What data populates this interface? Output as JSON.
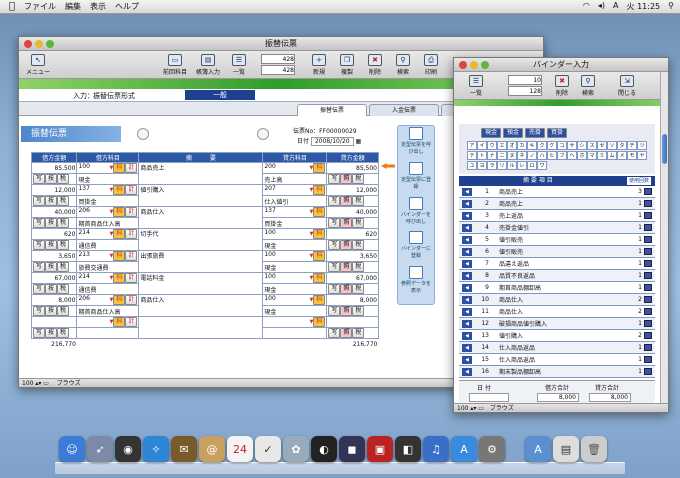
{
  "menubar": {
    "items": [
      "ファイル",
      "編集",
      "表示",
      "ヘルプ"
    ],
    "clock": "火 11:25",
    "user": "A"
  },
  "main": {
    "title": "振替伝票",
    "toolbar": {
      "menu": "メニュー",
      "prev": "前回科目",
      "swap": "帳簿入力",
      "list": "一覧",
      "rec1": "428",
      "rec2": "428",
      "new": "新規",
      "copy": "複製",
      "delete": "削除",
      "search": "検索",
      "print": "印刷"
    },
    "input_label": "入力：",
    "form_type": "振替伝票形式",
    "mode": "一般",
    "tabs": [
      "振替伝票",
      "入金伝票",
      "出金伝"
    ],
    "voucher_title": "振替伝票",
    "voucher_no_label": "伝票No：",
    "voucher_no": "FF00000029",
    "date_label": "日付",
    "date": "2008/10/20",
    "headers": [
      "借方金額",
      "借方科目",
      "摘　　　要",
      "貸方科目",
      "貸方金額"
    ],
    "rows": [
      {
        "debit_amt": "85,500",
        "debit_code": "100",
        "debit_name": "現金",
        "memo": "商品売上",
        "credit_code": "200",
        "credit_name": "売上高",
        "credit_amt": "85,500"
      },
      {
        "debit_amt": "12,000",
        "debit_code": "137",
        "debit_name": "買掛金",
        "memo": "値引購入",
        "credit_code": "207",
        "credit_name": "仕入値引",
        "credit_amt": "12,000"
      },
      {
        "debit_amt": "40,000",
        "debit_code": "206",
        "debit_name": "期首商品仕入高",
        "memo": "商品仕入",
        "credit_code": "137",
        "credit_name": "買掛金",
        "credit_amt": "40,000"
      },
      {
        "debit_amt": "620",
        "debit_code": "214",
        "debit_name": "通信費",
        "memo": "切手代",
        "credit_code": "100",
        "credit_name": "現金",
        "credit_amt": "620"
      },
      {
        "debit_amt": "3,650",
        "debit_code": "213",
        "debit_name": "旅費交通費",
        "memo": "出張旅費",
        "credit_code": "100",
        "credit_name": "現金",
        "credit_amt": "3,650"
      },
      {
        "debit_amt": "67,000",
        "debit_code": "214",
        "debit_name": "通信費",
        "memo": "電話料金",
        "credit_code": "100",
        "credit_name": "現金",
        "credit_amt": "67,000"
      },
      {
        "debit_amt": "8,000",
        "debit_code": "206",
        "debit_name": "期首商品仕入高",
        "memo": "商品仕入",
        "credit_code": "100",
        "credit_name": "現金",
        "credit_amt": "8,000"
      },
      {
        "debit_amt": "",
        "debit_code": "",
        "debit_name": "",
        "memo": "",
        "credit_code": "",
        "credit_name": "",
        "credit_amt": ""
      }
    ],
    "total_debit": "216,770",
    "total_credit": "216,770",
    "row_btns": {
      "copy": "写",
      "dup": "按",
      "tax": "税",
      "ka": "科",
      "kei": "計",
      "sho": "照"
    },
    "side": [
      "定型伝票を呼び出し",
      "定型伝票に登録",
      "バインダーを呼び出し",
      "バインダーに登録",
      "参照データを表示"
    ],
    "status_zoom": "100",
    "status_mode": "ブラウズ"
  },
  "binder": {
    "title": "バインダー入力",
    "toolbar": {
      "list": "一覧",
      "rec1": "10",
      "rec2": "128",
      "delete": "削除",
      "search": "検索",
      "close": "閉じる"
    },
    "cats": [
      "現金",
      "預金",
      "売掛",
      "買掛"
    ],
    "kana": [
      "ア",
      "イ",
      "ウ",
      "エ",
      "オ",
      "カ",
      "キ",
      "ク",
      "ケ",
      "コ",
      "サ",
      "シ",
      "ス",
      "セ",
      "ソ",
      "タ",
      "チ",
      "ツ",
      "テ",
      "ト",
      "ナ",
      "ニ",
      "ヌ",
      "ネ",
      "ノ",
      "ハ",
      "ヒ",
      "フ",
      "ヘ",
      "ホ",
      "マ",
      "ミ",
      "ム",
      "メ",
      "モ",
      "ヤ",
      "ユ",
      "ヨ",
      "ラ",
      "リ",
      "ル",
      "レ",
      "ロ",
      "ワ"
    ],
    "list_header": "摘 要 項 目",
    "usage_header": "使用回数",
    "items": [
      {
        "no": "1",
        "name": "商品売上",
        "count": "3"
      },
      {
        "no": "2",
        "name": "商品売上",
        "count": "1"
      },
      {
        "no": "3",
        "name": "売上返品",
        "count": "1"
      },
      {
        "no": "4",
        "name": "売掛金値引",
        "count": "1"
      },
      {
        "no": "5",
        "name": "値引販売",
        "count": "1"
      },
      {
        "no": "6",
        "name": "値引販売",
        "count": "1"
      },
      {
        "no": "7",
        "name": "品違え返品",
        "count": "1"
      },
      {
        "no": "8",
        "name": "品質不良返品",
        "count": "1"
      },
      {
        "no": "9",
        "name": "期首商品棚卸高",
        "count": "1"
      },
      {
        "no": "10",
        "name": "商品仕入",
        "count": "2"
      },
      {
        "no": "11",
        "name": "商品仕入",
        "count": "2"
      },
      {
        "no": "12",
        "name": "破損商品値引購入",
        "count": "1"
      },
      {
        "no": "13",
        "name": "値引購入",
        "count": "2"
      },
      {
        "no": "14",
        "name": "仕入商品返品",
        "count": "1"
      },
      {
        "no": "15",
        "name": "仕入商品返品",
        "count": "1"
      },
      {
        "no": "16",
        "name": "期末製品棚卸高",
        "count": "1"
      }
    ],
    "footer": {
      "date_label": "日 付",
      "debit_label": "借方合計",
      "debit": "8,000",
      "credit_label": "貸方合計",
      "credit": "8,000"
    },
    "status_zoom": "100",
    "status_mode": "ブラウズ"
  }
}
